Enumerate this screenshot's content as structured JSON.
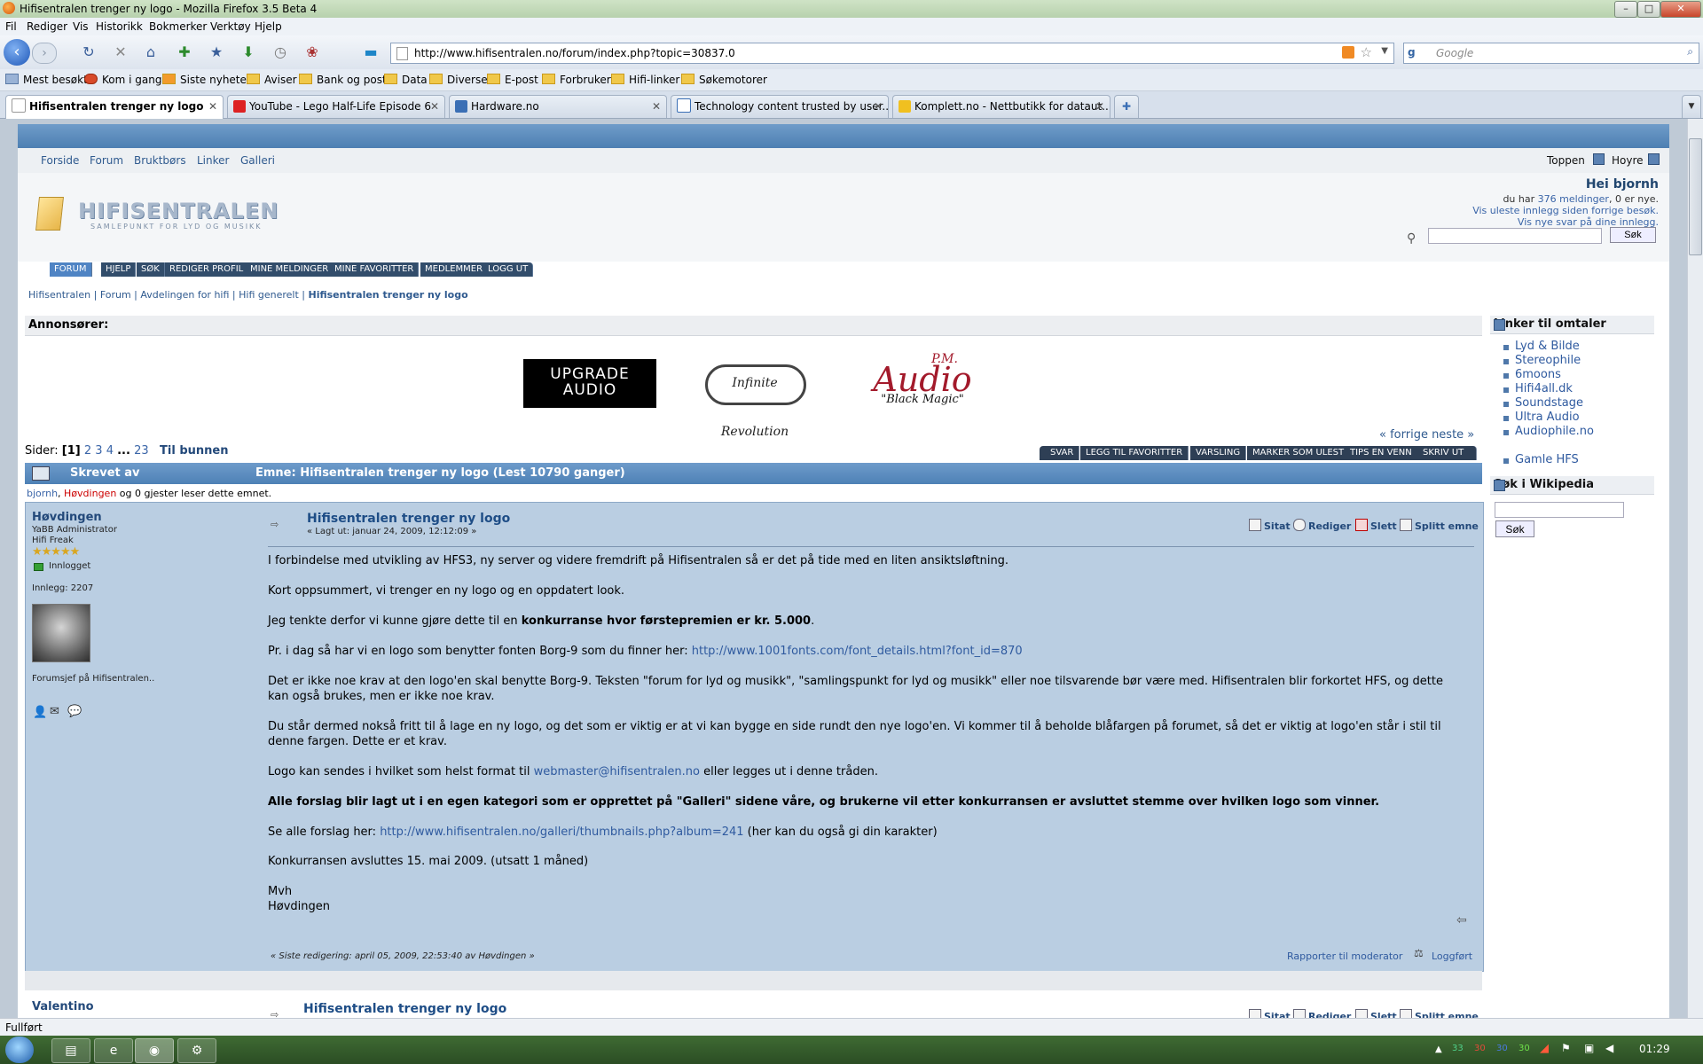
{
  "window": {
    "title": "Hifisentralen trenger ny logo - Mozilla Firefox 3.5 Beta 4"
  },
  "menu": [
    "Fil",
    "Rediger",
    "Vis",
    "Historikk",
    "Bokmerker",
    "Verktøy",
    "Hjelp"
  ],
  "nav": {
    "url": "http://www.hifisentralen.no/forum/index.php?topic=30837.0",
    "search_placeholder": "Google"
  },
  "bookmarks": [
    "Mest besøkt",
    "Kom i gang",
    "Siste nyheter",
    "Aviser",
    "Bank og post",
    "Data",
    "Diverse",
    "E-post",
    "Forbruker",
    "Hifi-linker",
    "Søkemotorer"
  ],
  "tabs": [
    {
      "label": "Hifisentralen trenger ny logo",
      "active": true
    },
    {
      "label": "YouTube - Lego Half-Life Episode 6"
    },
    {
      "label": "Hardware.no"
    },
    {
      "label": "Technology content trusted by user..."
    },
    {
      "label": "Komplett.no - Nettbutikk for dataut..."
    }
  ],
  "site": {
    "toplinks": [
      "Forside",
      "Forum",
      "Bruktbørs",
      "Linker",
      "Galleri"
    ],
    "top_right": {
      "toppen": "Toppen",
      "hoyre": "Hoyre"
    },
    "logo": {
      "name": "HIFISENTRALEN",
      "tagline": "SAMLEPUNKT FOR LYD OG MUSIKK"
    },
    "user": {
      "greeting": "Hei bjornh",
      "du_har": "du har",
      "messages_link": "376 meldinger",
      "new_count": ", 0 er nye.",
      "unread_link": "Vis uleste innlegg siden forrige besøk.",
      "new_replies_link": "Vis nye svar på dine innlegg.",
      "search_button": "Søk"
    },
    "menu_tabs": [
      "FORUM",
      "HJELP",
      "SØK",
      "REDIGER PROFIL",
      "MINE MELDINGER",
      "MINE FAVORITTER",
      "MEDLEMMER",
      "LOGG UT"
    ],
    "breadcrumb": [
      "Hifisentralen",
      "Forum",
      "Avdelingen for hifi",
      "Hifi generelt",
      "Hifisentralen trenger ny logo"
    ],
    "advertisers_label": "Annonsører:",
    "ads": {
      "upgrade": [
        "UPGRADE",
        "AUDIO"
      ],
      "infinite": "Infinite Revolution",
      "pm_small": "P.M.",
      "pm_big": "Audio",
      "pm_tag": "\"Black Magic\""
    },
    "pager": {
      "label": "Sider:",
      "current": "[1]",
      "pages": [
        "2",
        "3",
        "4",
        "...",
        "23"
      ],
      "bottom": "Til bunnen"
    },
    "prevnext": "« forrige neste »",
    "action_buttons": [
      "SVAR",
      "LEGG TIL FAVORITTER",
      "VARSLING",
      "MARKER SOM ULEST",
      "TIPS EN VENN",
      "SKRIV UT"
    ],
    "thread_header": {
      "author_col": "Skrevet av",
      "subject": "Emne: Hifisentralen trenger ny logo  (Lest 10790 ganger)"
    },
    "viewers": {
      "user1": "bjornh",
      "user2": "Høvdingen",
      "rest": " og 0 gjester leser dette emnet."
    },
    "post1": {
      "author": "Høvdingen",
      "role1": "YaBB Administrator",
      "role2": "Hifi Freak",
      "stars": "★★★★★",
      "online": "Innlogget",
      "posts": "Innlegg: 2207",
      "personal_text": "Forumsjef på Hifisentralen..",
      "title": "Hifisentralen trenger ny logo",
      "date": "« Lagt ut: januar 24, 2009, 12:12:09 »",
      "actions": [
        "Sitat",
        "Rediger",
        "Slett",
        "Splitt emne"
      ],
      "p1": "I forbindelse med utvikling av HFS3, ny server og videre fremdrift på Hifisentralen så er det på tide med en liten ansiktsløftning.",
      "p2": "Kort oppsummert, vi trenger en ny logo og en oppdatert look.",
      "p3a": "Jeg tenkte derfor vi kunne gjøre dette til en ",
      "p3b": "konkurranse hvor førstepremien er kr. 5.000",
      "p3c": ".",
      "p4a": "Pr. i dag så har vi en logo som benytter fonten Borg-9 som du finner her: ",
      "p4link": "http://www.1001fonts.com/font_details.html?font_id=870",
      "p5": "Det er ikke noe krav at den logo'en skal benytte Borg-9. Teksten \"forum for lyd og musikk\", \"samlingspunkt for lyd og musikk\" eller noe tilsvarende bør være med. Hifisentralen blir forkortet HFS, og dette kan også brukes, men er ikke noe krav.",
      "p6": "Du står dermed nokså fritt til å lage en ny logo, og det som er viktig er at vi kan bygge en side rundt den nye logo'en. Vi kommer til å beholde blåfargen på forumet, så det er viktig at logo'en står i stil til denne fargen. Dette er et krav.",
      "p7a": "Logo kan sendes i hvilket som helst format til ",
      "p7link": "webmaster@hifisentralen.no",
      "p7b": " eller legges ut i denne tråden.",
      "p8": "Alle forslag blir lagt ut i en egen kategori som er opprettet på \"Galleri\" sidene våre, og brukerne vil etter konkurransen er avsluttet stemme over hvilken logo som vinner.",
      "p9a": "Se alle forslag her: ",
      "p9link": "http://www.hifisentralen.no/galleri/thumbnails.php?album=241",
      "p9b": " (her kan du også gi din karakter)",
      "p10": "Konkurransen avsluttes 15. mai 2009. (utsatt 1 måned)",
      "sig1": "Mvh",
      "sig2": "Høvdingen",
      "edited": "« Siste redigering: april 05, 2009, 22:53:40 av Høvdingen »",
      "report": "Rapporter til moderator",
      "logged": "Loggført"
    },
    "post2": {
      "author": "Valentino",
      "title": "Hifisentralen trenger ny logo",
      "actions": [
        "Sitat",
        "Rediger",
        "Slett",
        "Splitt emne"
      ]
    },
    "sidebar": {
      "links_title": "Linker til omtaler",
      "links": [
        "Lyd & Bilde",
        "Stereophile",
        "6moons",
        "Hifi4all.dk",
        "Soundstage",
        "Ultra Audio",
        "Audiophile.no"
      ],
      "old": "Gamle HFS",
      "wiki_title": "Søk i Wikipedia",
      "wiki_button": "Søk"
    }
  },
  "status": "Fullført",
  "tray": {
    "n1": "33",
    "n2": "30",
    "n3": "30",
    "n4": "30",
    "time": "01:29"
  }
}
